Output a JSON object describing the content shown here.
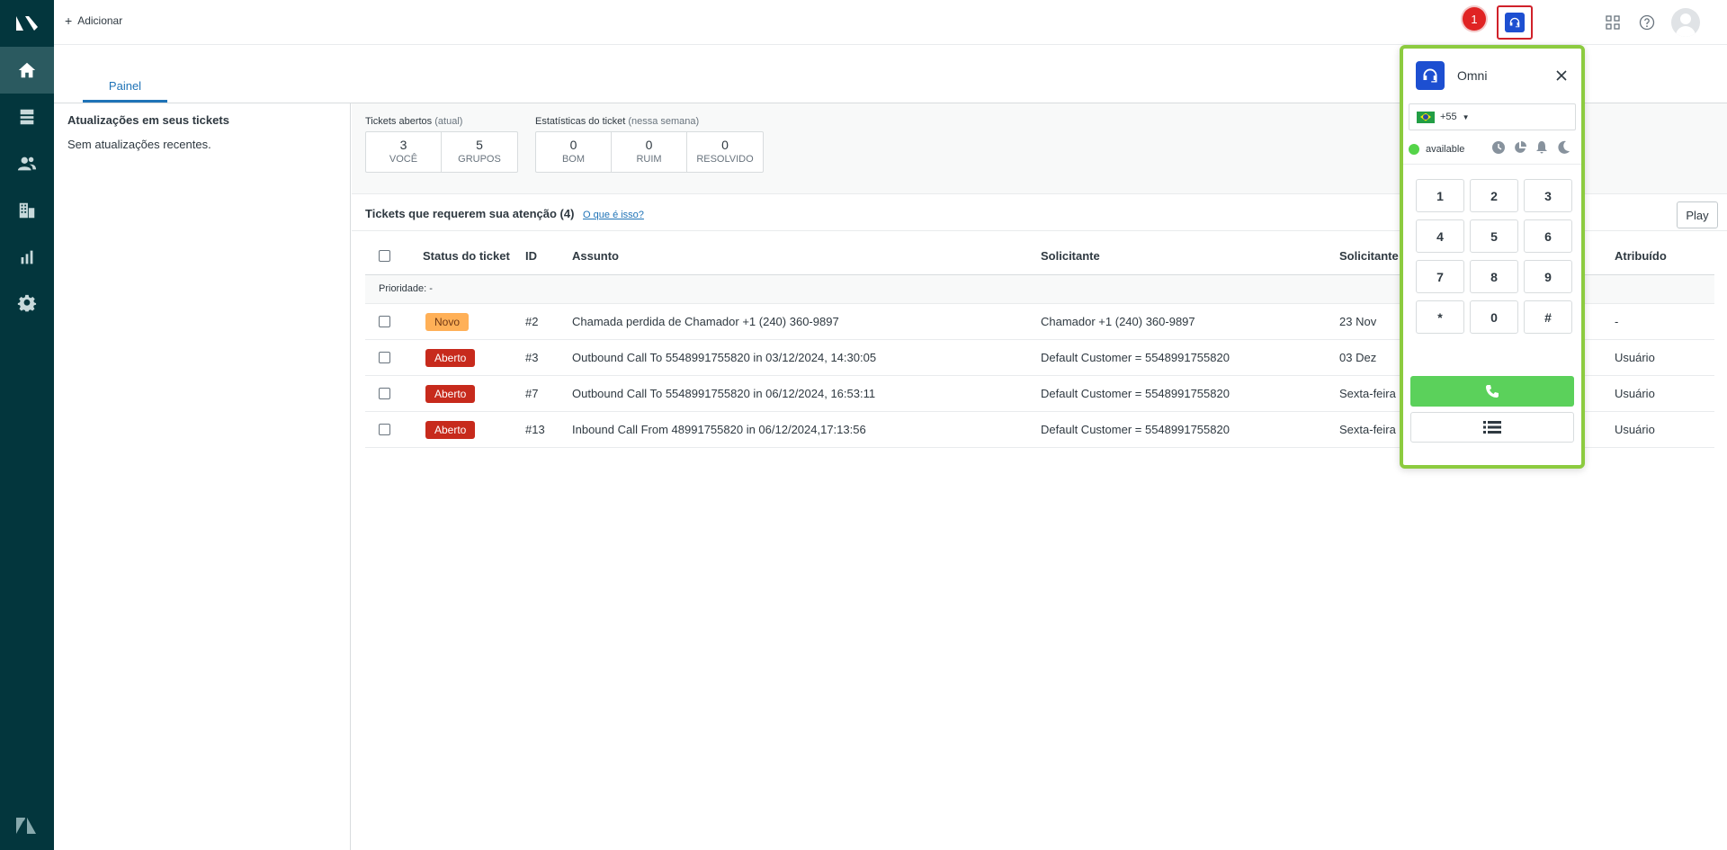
{
  "topbar": {
    "add_label": "Adicionar",
    "notification_count": "1"
  },
  "tab": {
    "label": "Painel"
  },
  "updates": {
    "title": "Atualizações em seus tickets",
    "empty": "Sem atualizações recentes."
  },
  "open_tickets": {
    "title": "Tickets abertos",
    "qualifier": "(atual)",
    "boxes": [
      {
        "value": "3",
        "label": "VOCÊ"
      },
      {
        "value": "5",
        "label": "GRUPOS"
      }
    ]
  },
  "ticket_stats": {
    "title": "Estatísticas do ticket",
    "qualifier": "(nessa semana)",
    "boxes": [
      {
        "value": "0",
        "label": "BOM"
      },
      {
        "value": "0",
        "label": "RUIM"
      },
      {
        "value": "0",
        "label": "RESOLVIDO"
      }
    ]
  },
  "attention": {
    "title": "Tickets que requerem sua atenção (4)",
    "link": "O que é isso?",
    "play": "Play"
  },
  "table": {
    "headers": {
      "status": "Status do ticket",
      "id": "ID",
      "subject": "Assunto",
      "requester": "Solicitante",
      "requester_updated": "Solicitante",
      "assignee": "Atribuído"
    },
    "group_label": "Prioridade: -",
    "rows": [
      {
        "status": "Novo",
        "id": "#2",
        "subject": "Chamada perdida de Chamador +1 (240) 360-9897",
        "requester": "Chamador +1 (240) 360-9897",
        "date": "23 Nov",
        "assignee": "-"
      },
      {
        "status": "Aberto",
        "id": "#3",
        "subject": "Outbound Call To 5548991755820 in 03/12/2024, 14:30:05",
        "requester": "Default Customer = 5548991755820",
        "date": "03 Dez",
        "assignee": "Usuário"
      },
      {
        "status": "Aberto",
        "id": "#7",
        "subject": "Outbound Call To 5548991755820 in 06/12/2024, 16:53:11",
        "requester": "Default Customer = 5548991755820",
        "date": "Sexta-feira",
        "assignee": "Usuário"
      },
      {
        "status": "Aberto",
        "id": "#13",
        "subject": "Inbound Call From 48991755820 in 06/12/2024,17:13:56",
        "requester": "Default Customer = 5548991755820",
        "date": "Sexta-feira",
        "assignee": "Usuário"
      }
    ]
  },
  "omni": {
    "name": "Omni",
    "country_code": "+55",
    "status": "available",
    "keys": [
      "1",
      "2",
      "3",
      "4",
      "5",
      "6",
      "7",
      "8",
      "9",
      "*",
      "0",
      "#"
    ],
    "status_color": "#55d449",
    "accent": "#8ccb3f"
  }
}
